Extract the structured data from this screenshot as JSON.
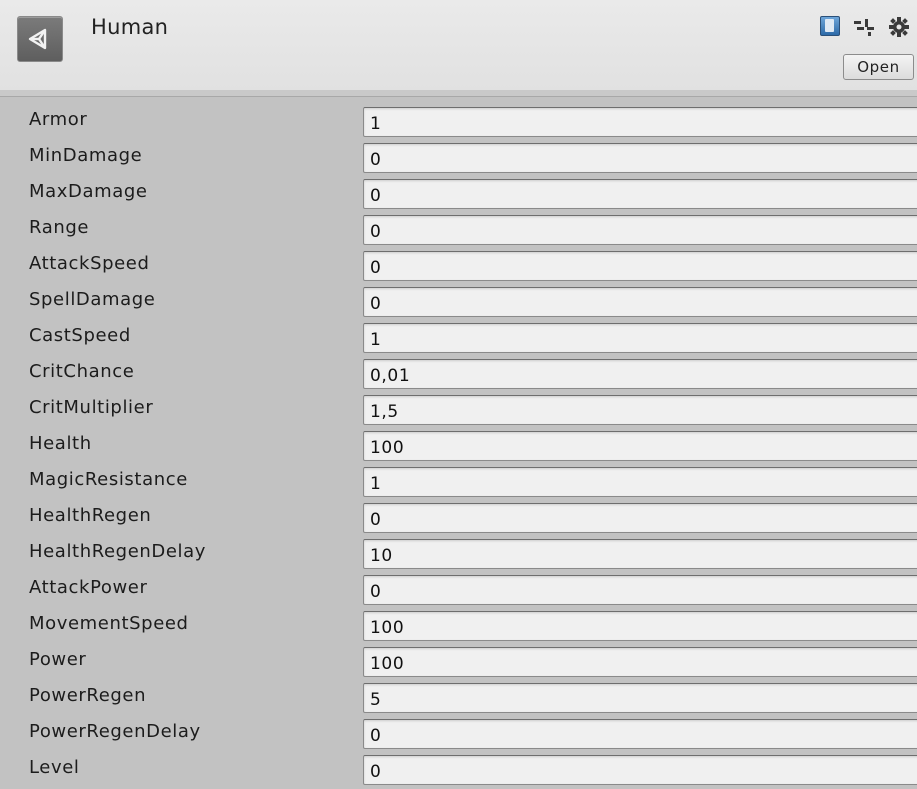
{
  "header": {
    "title": "Human",
    "open_label": "Open",
    "icons": [
      "unity-logo-icon",
      "help-icon",
      "preset-icon",
      "gear-icon"
    ]
  },
  "properties": [
    {
      "label": "Armor",
      "value": "1"
    },
    {
      "label": "MinDamage",
      "value": "0"
    },
    {
      "label": "MaxDamage",
      "value": "0"
    },
    {
      "label": "Range",
      "value": "0"
    },
    {
      "label": "AttackSpeed",
      "value": "0"
    },
    {
      "label": "SpellDamage",
      "value": "0"
    },
    {
      "label": "CastSpeed",
      "value": "1"
    },
    {
      "label": "CritChance",
      "value": "0,01"
    },
    {
      "label": "CritMultiplier",
      "value": "1,5"
    },
    {
      "label": "Health",
      "value": "100"
    },
    {
      "label": "MagicResistance",
      "value": "1"
    },
    {
      "label": "HealthRegen",
      "value": "0"
    },
    {
      "label": "HealthRegenDelay",
      "value": "10"
    },
    {
      "label": "AttackPower",
      "value": "0"
    },
    {
      "label": "MovementSpeed",
      "value": "100"
    },
    {
      "label": "Power",
      "value": "100"
    },
    {
      "label": "PowerRegen",
      "value": "5"
    },
    {
      "label": "PowerRegenDelay",
      "value": "0"
    },
    {
      "label": "Level",
      "value": "0"
    }
  ]
}
